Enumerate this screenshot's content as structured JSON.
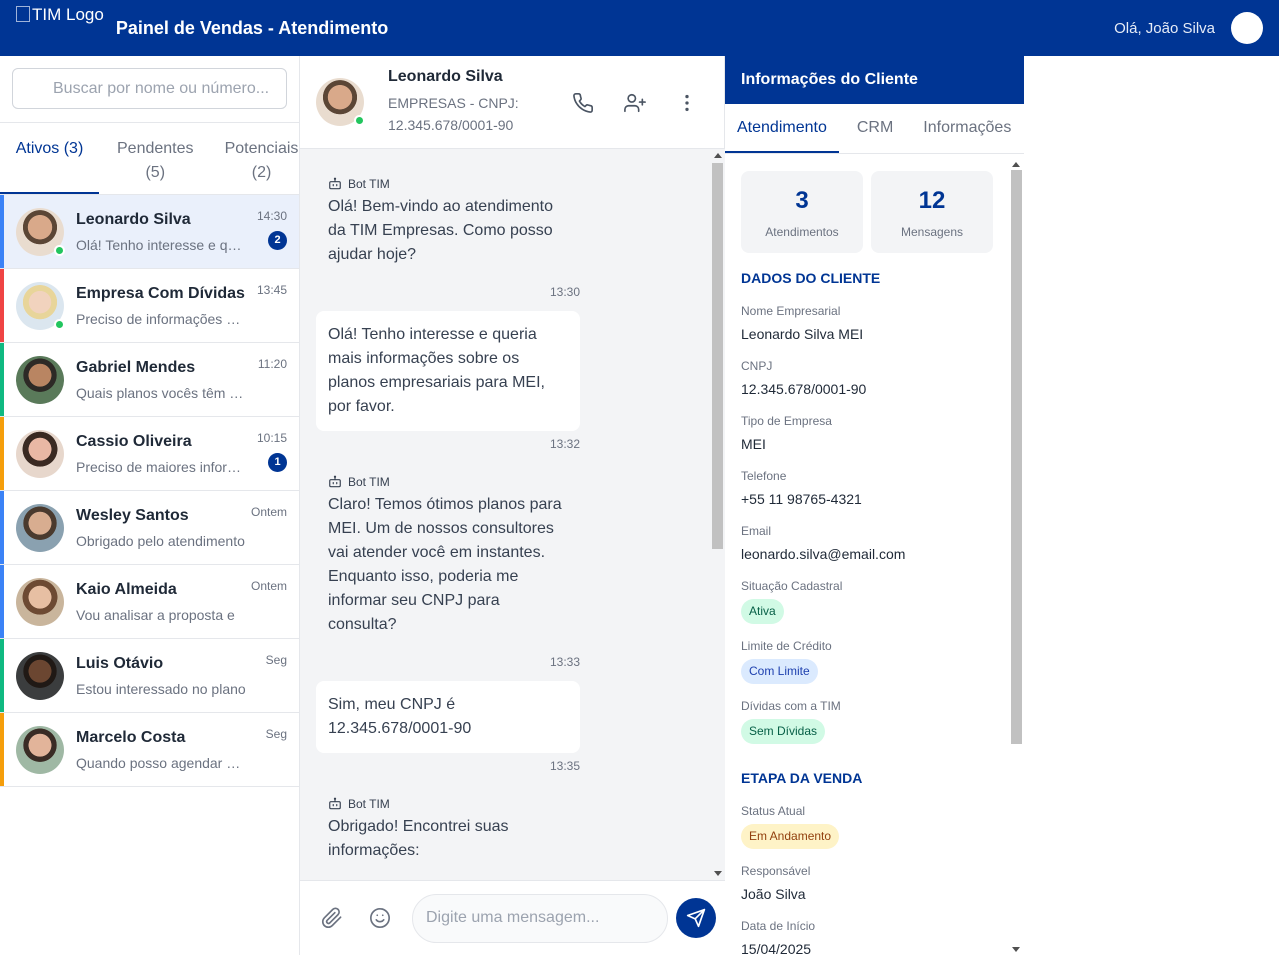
{
  "header": {
    "logo_alt": "TIM Logo",
    "title": "Painel de Vendas - Atendimento",
    "greeting": "Olá, João Silva",
    "brand_color": "#003594"
  },
  "sidebar": {
    "search_placeholder": "Buscar por nome ou número...",
    "tabs": [
      {
        "label": "Ativos (3)",
        "active": true
      },
      {
        "label": "Pendentes (5)"
      },
      {
        "label": "Potenciais (2)"
      }
    ],
    "conversations": [
      {
        "name": "Leonardo Silva",
        "time": "14:30",
        "preview": "Olá! Tenho interesse e queria mais informações",
        "badge": "2",
        "online": true,
        "stripe": "#3b82f6",
        "selected": true
      },
      {
        "name": "Empresa Com Dívidas",
        "time": "13:45",
        "preview": "Preciso de informações sobre",
        "badge": "",
        "online": true,
        "stripe": "#ef4444"
      },
      {
        "name": "Gabriel Mendes",
        "time": "11:20",
        "preview": "Quais planos vocês têm para",
        "badge": "",
        "online": false,
        "stripe": "#10b981"
      },
      {
        "name": "Cassio Oliveira",
        "time": "10:15",
        "preview": "Preciso de maiores informações",
        "badge": "1",
        "online": false,
        "stripe": "#f59e0b"
      },
      {
        "name": "Wesley Santos",
        "time": "Ontem",
        "preview": "Obrigado pelo atendimento",
        "badge": "",
        "online": false,
        "stripe": "#3b82f6"
      },
      {
        "name": "Kaio Almeida",
        "time": "Ontem",
        "preview": "Vou analisar a proposta e",
        "badge": "",
        "online": false,
        "stripe": "#3b82f6"
      },
      {
        "name": "Luis Otávio",
        "time": "Seg",
        "preview": "Estou interessado no plano",
        "badge": "",
        "online": false,
        "stripe": "#10b981"
      },
      {
        "name": "Marcelo Costa",
        "time": "Seg",
        "preview": "Quando posso agendar uma",
        "badge": "",
        "online": false,
        "stripe": "#f59e0b"
      }
    ]
  },
  "chat": {
    "contact_name": "Leonardo Silva",
    "contact_sub": "EMPRESAS - CNPJ: 12.345.678/0001-90",
    "messages": [
      {
        "from": "bot",
        "sender": "Bot TIM",
        "text": "Olá! Bem-vindo ao atendimento da TIM Empresas. Como posso ajudar hoje?",
        "time": "13:30"
      },
      {
        "from": "user",
        "sender": "",
        "text": "Olá! Tenho interesse e queria mais informações sobre os planos empresariais para MEI, por favor.",
        "time": "13:32"
      },
      {
        "from": "bot",
        "sender": "Bot TIM",
        "text": "Claro! Temos ótimos planos para MEI. Um de nossos consultores vai atender você em instantes. Enquanto isso, poderia me informar seu CNPJ para consulta?",
        "time": "13:33"
      },
      {
        "from": "user",
        "sender": "",
        "text": "Sim, meu CNPJ é 12.345.678/0001-90",
        "time": "13:35"
      },
      {
        "from": "bot",
        "sender": "Bot TIM",
        "text": "Obrigado! Encontrei suas informações:",
        "time": ""
      }
    ],
    "input_placeholder": "Digite uma mensagem..."
  },
  "client_panel": {
    "title": "Informações do Cliente",
    "tabs": [
      {
        "label": "Atendimento",
        "active": true
      },
      {
        "label": "CRM"
      },
      {
        "label": "Informações"
      }
    ],
    "stats": [
      {
        "value": "3",
        "label": "Atendimentos"
      },
      {
        "value": "12",
        "label": "Mensagens"
      }
    ],
    "client_section_title": "DADOS DO CLIENTE",
    "fields": [
      {
        "label": "Nome Empresarial",
        "value": "Leonardo Silva MEI"
      },
      {
        "label": "CNPJ",
        "value": "12.345.678/0001-90"
      },
      {
        "label": "Tipo de Empresa",
        "value": "MEI"
      },
      {
        "label": "Telefone",
        "value": "+55 11 98765-4321"
      },
      {
        "label": "Email",
        "value": "leonardo.silva@email.com"
      }
    ],
    "status_fields": [
      {
        "label": "Situação Cadastral",
        "value": "Ativa",
        "color": "green"
      },
      {
        "label": "Limite de Crédito",
        "value": "Com Limite",
        "color": "blue"
      },
      {
        "label": "Dívidas com a TIM",
        "value": "Sem Dívidas",
        "color": "green"
      }
    ],
    "sale_section_title": "ETAPA DA VENDA",
    "sale": {
      "status_label": "Status Atual",
      "status_value": "Em Andamento",
      "owner_label": "Responsável",
      "owner_value": "João Silva",
      "start_label": "Data de Início",
      "start_value": "15/04/2025"
    }
  }
}
